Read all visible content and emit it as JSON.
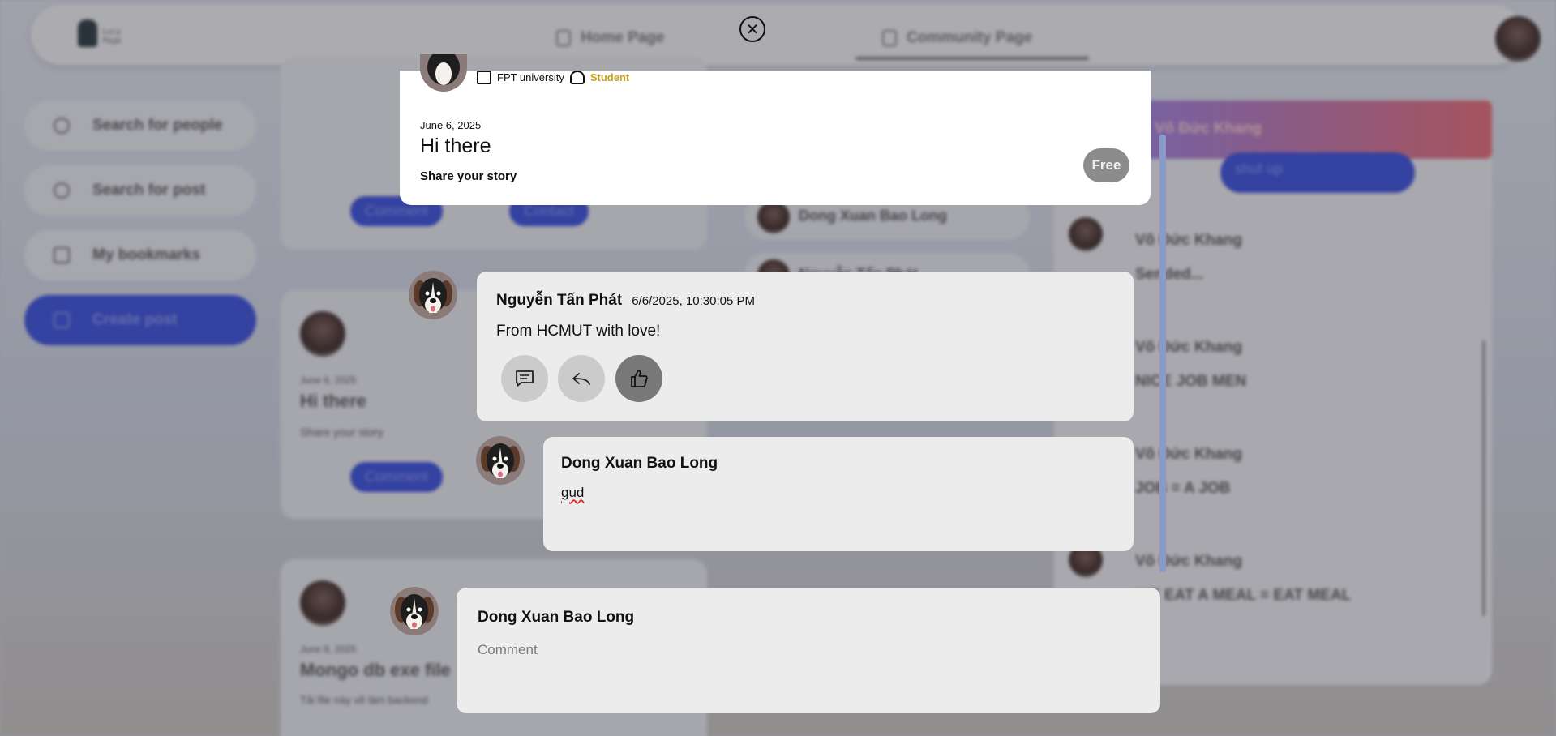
{
  "navbar": {
    "logo_text": "Lucy Page",
    "tabs": [
      {
        "label": "Home Page"
      },
      {
        "label": "Community Page"
      }
    ],
    "active_tab": "Community Page"
  },
  "sidebar": {
    "items": [
      {
        "label": "Search for people",
        "icon": "person-search-icon"
      },
      {
        "label": "Search for post",
        "icon": "search-icon"
      },
      {
        "label": "My bookmarks",
        "icon": "bookmark-icon"
      },
      {
        "label": "Create post",
        "icon": "document-icon"
      }
    ]
  },
  "background": {
    "left_feed": {
      "buttons": [
        "Comment",
        "Contact"
      ],
      "cards": [
        {
          "date": "June 6, 2025",
          "title": "Hi there",
          "body": "Share your story"
        },
        {
          "date": "June 6, 2025",
          "title": "Mongo db exe file",
          "body": "Tải file này về làm backend"
        }
      ]
    },
    "people_list": [
      "Dong Xuan Bao Long",
      "Nguyễn Tấn Phát"
    ],
    "chat": {
      "header": "Võ Đức Khang",
      "button": "shut up",
      "messages": [
        {
          "name": "Võ Đức Khang",
          "text": "Sended..."
        },
        {
          "name": "Võ Đức Khang",
          "text": "NICE JOB MEN"
        },
        {
          "name": "Võ Đức Khang",
          "text": "JOB = A JOB"
        },
        {
          "name": "Võ Đức Khang",
          "text": "WE EAT A MEAL = EAT MEAL"
        }
      ]
    }
  },
  "modal": {
    "post": {
      "university": "FPT university",
      "role": "Student",
      "date": "June 6, 2025",
      "title": "Hi there",
      "body": "Share your story",
      "badge": "Free"
    },
    "comments": [
      {
        "author": "Nguyễn Tấn Phát",
        "timestamp": "6/6/2025, 10:30:05 PM",
        "text": "From HCMUT with love!"
      },
      {
        "author": "Dong Xuan Bao Long",
        "text": "gud"
      }
    ],
    "composer": {
      "author": "Dong Xuan Bao Long",
      "placeholder": "Comment"
    }
  },
  "colors": {
    "accent": "#3b4fd8",
    "role_gold": "#c7a31a",
    "badge_gray": "#8c8c8c",
    "card_bg": "#ececec"
  }
}
